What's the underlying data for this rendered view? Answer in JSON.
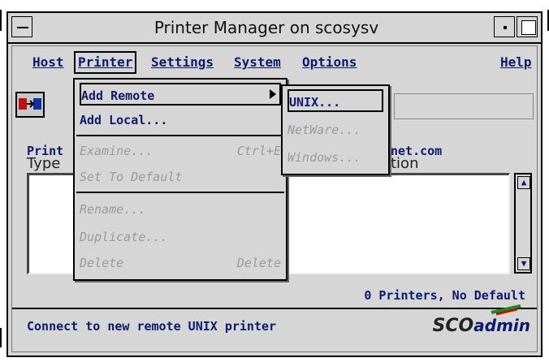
{
  "window": {
    "title": "Printer Manager on scosysv"
  },
  "menubar": {
    "items": [
      {
        "label": "Host"
      },
      {
        "label": "Printer"
      },
      {
        "label": "Settings"
      },
      {
        "label": "System"
      },
      {
        "label": "Options"
      },
      {
        "label": "Help"
      }
    ]
  },
  "content": {
    "printer_label": "Print",
    "host_suffix": "net.com",
    "type_label": "Type",
    "location_suffix": "tion",
    "count_text": "0 Printers, No Default"
  },
  "status": {
    "message": "Connect to new remote UNIX printer",
    "logo_sco": "SCO",
    "logo_admin": "admin"
  },
  "printer_menu": {
    "items": [
      {
        "label": "Add Remote",
        "enabled": true,
        "submenu": true
      },
      {
        "label": "Add Local...",
        "enabled": true
      },
      {
        "label": "Examine...",
        "accel": "Ctrl+E",
        "enabled": false
      },
      {
        "label": "Set To Default",
        "enabled": false
      },
      {
        "label": "Rename...",
        "enabled": false
      },
      {
        "label": "Duplicate...",
        "enabled": false
      },
      {
        "label": "Delete",
        "accel": "Delete",
        "enabled": false
      }
    ]
  },
  "remote_submenu": {
    "items": [
      {
        "label": "UNIX...",
        "enabled": true
      },
      {
        "label": "NetWare...",
        "enabled": false
      },
      {
        "label": "Windows...",
        "enabled": false
      }
    ]
  },
  "colors": {
    "text_blue": "#0c1a6e",
    "window_bg": "#d6d6d6",
    "disabled": "#9a9a9a"
  }
}
